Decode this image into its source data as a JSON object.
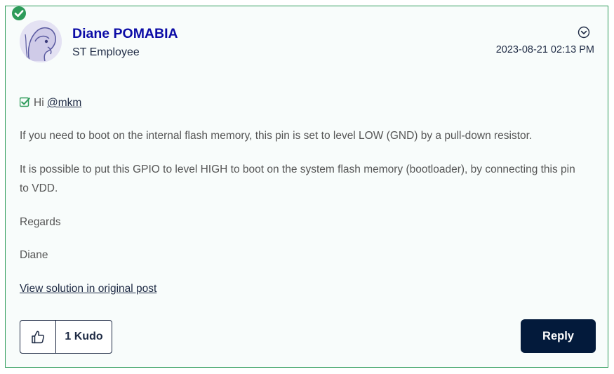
{
  "post": {
    "author_name": "Diane POMABIA",
    "author_rank": "ST Employee",
    "date": "2023-08-21 02:13 PM",
    "greeting_prefix": "Hi ",
    "mention": "@mkm",
    "paragraphs": [
      "If you need to boot on the internal flash memory, this pin is set to level LOW (GND) by a pull-down resistor.",
      "It is possible to put this GPIO to level HIGH to boot on the system flash memory (bootloader), by connecting  this pin to VDD.",
      "Regards",
      "Diane"
    ],
    "view_solution_link": "View solution in original post"
  },
  "actions": {
    "kudo_count": "1 Kudo",
    "reply_label": "Reply"
  },
  "icons": {
    "solution_badge": "check-circle-icon",
    "options": "chevron-down-circle-icon",
    "greeting_check": "checkbox-check-icon",
    "kudo": "thumbs-up-icon"
  },
  "colors": {
    "accent_green": "#2e9b5a",
    "author_blue": "#0b0ba6",
    "navy": "#031a3b",
    "text_gray": "#555555"
  }
}
